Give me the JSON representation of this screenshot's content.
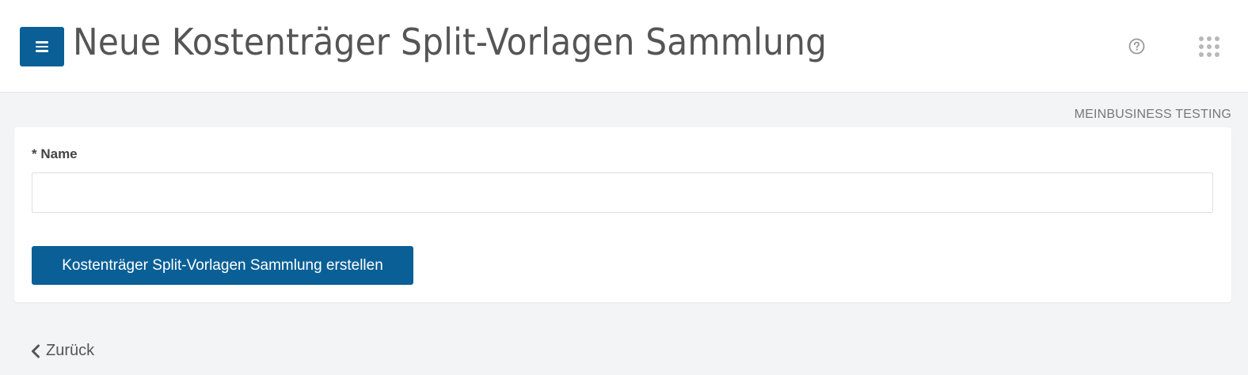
{
  "header": {
    "title": "Neue Kostenträger Split-Vorlagen Sammlung",
    "menu_icon": "hamburger-menu-icon",
    "help_icon": "help-circle-icon",
    "apps_icon": "apps-grid-icon"
  },
  "organization": {
    "label": "MEINBUSINESS TESTING"
  },
  "form": {
    "name_label": "* Name",
    "name_value": "",
    "name_placeholder": "",
    "submit_label": "Kostenträger Split-Vorlagen Sammlung erstellen"
  },
  "footer": {
    "back_label": "Zurück",
    "back_icon": "chevron-left-icon"
  },
  "colors": {
    "primary": "#0a5f96",
    "background": "#f3f4f6",
    "surface": "#ffffff",
    "text": "#555555",
    "muted": "#777777"
  }
}
